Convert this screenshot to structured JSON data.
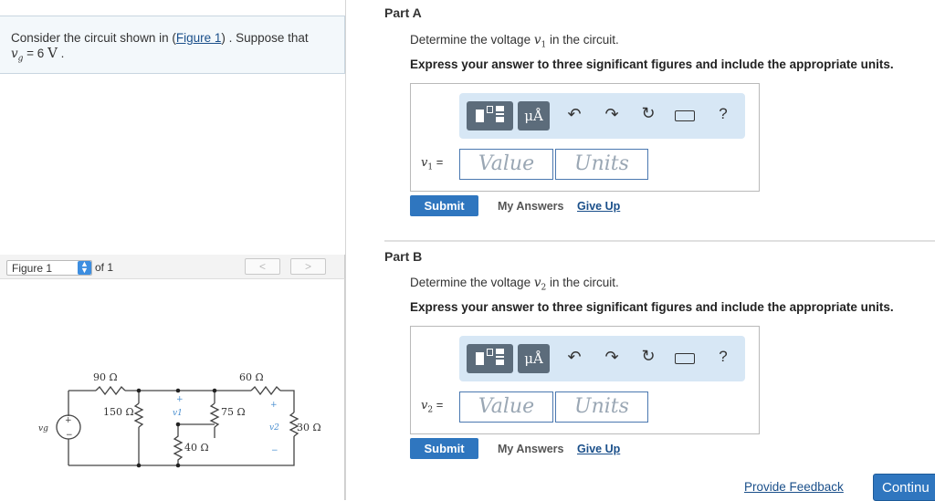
{
  "problem": {
    "text_prefix": "Consider the circuit shown in (",
    "figure_link": "Figure 1",
    "text_suffix": ") . Suppose that",
    "vg_symbol": "v",
    "vg_sub": "g",
    "vg_value": " = 6 ",
    "vg_unit": "V",
    "period": " ."
  },
  "figure": {
    "select_label": "Figure 1",
    "of_text": "of 1",
    "prev": "<",
    "next": ">",
    "labels": {
      "r1": "90 Ω",
      "r2": "150 Ω",
      "r3": "75 Ω",
      "r4": "60 Ω",
      "r5": "30 Ω",
      "r6": "40 Ω",
      "v1": "v1",
      "v2": "v2",
      "vg": "vg",
      "plus": "+",
      "minus": "−"
    }
  },
  "partA": {
    "title": "Part A",
    "question_prefix": "Determine the voltage ",
    "var": "v",
    "sub": "1",
    "question_suffix": " in the circuit.",
    "instruction": "Express your answer to three significant figures and include the appropriate units.",
    "answer_label_var": "v",
    "answer_label_sub": "1",
    "answer_label_eq": " =",
    "value_placeholder": "Value",
    "units_placeholder": "Units",
    "submit": "Submit",
    "my_answers": "My Answers",
    "give_up": "Give Up"
  },
  "partB": {
    "title": "Part B",
    "question_prefix": "Determine the voltage ",
    "var": "v",
    "sub": "2",
    "question_suffix": " in the circuit.",
    "instruction": "Express your answer to three significant figures and include the appropriate units.",
    "answer_label_var": "v",
    "answer_label_sub": "2",
    "answer_label_eq": " =",
    "value_placeholder": "Value",
    "units_placeholder": "Units",
    "submit": "Submit",
    "my_answers": "My Answers",
    "give_up": "Give Up"
  },
  "toolbar": {
    "units_label": "μÅ",
    "help": "?",
    "icons": [
      "templates-icon",
      "units-icon",
      "undo-icon",
      "redo-icon",
      "reset-icon",
      "keyboard-icon",
      "help-icon"
    ]
  },
  "footer": {
    "feedback": "Provide Feedback",
    "continue": "Continu"
  },
  "colors": {
    "accent": "#2f76bf",
    "link": "#1a4f8a",
    "toolbar_bg": "#d7e7f5",
    "problem_bg": "#f3f8fb"
  }
}
